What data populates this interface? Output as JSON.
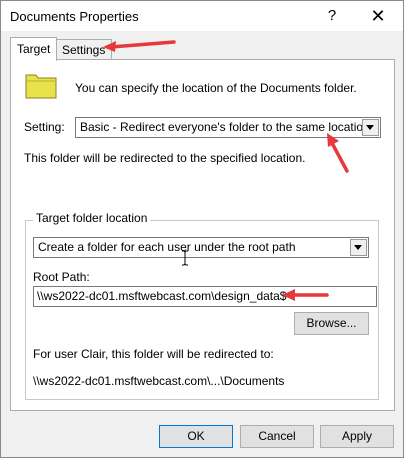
{
  "window": {
    "title": "Documents Properties",
    "help_glyph": "?",
    "close_glyph": "✕"
  },
  "tabs": [
    {
      "label": "Target",
      "active": true
    },
    {
      "label": "Settings",
      "active": false
    }
  ],
  "target": {
    "description": "You can specify the location of the Documents folder.",
    "setting_label": "Setting:",
    "setting_value": "Basic - Redirect everyone's folder to the same location",
    "redirect_note": "This folder will be redirected to the specified location.",
    "group": {
      "title": "Target folder location",
      "location_option": "Create a folder for each user under the root path",
      "root_path_label": "Root Path:",
      "root_path_value": "\\\\ws2022-dc01.msftwebcast.com\\design_data$",
      "browse_label": "Browse...",
      "user_note": "For user Clair, this folder will be redirected to:",
      "user_path": "\\\\ws2022-dc01.msftwebcast.com\\...\\Documents"
    }
  },
  "buttons": {
    "ok": "OK",
    "cancel": "Cancel",
    "apply": "Apply"
  },
  "colors": {
    "annotation_arrow": "#e5393b",
    "folder_fill": "#e8e24a",
    "default_button_border": "#0078d7"
  }
}
